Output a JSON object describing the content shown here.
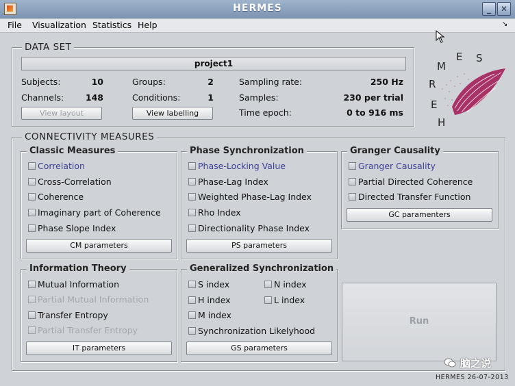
{
  "window": {
    "title": "HERMES"
  },
  "menu": [
    "File",
    "Visualization",
    "Statistics",
    "Help"
  ],
  "dataset": {
    "legend": "DATA SET",
    "project": "project1",
    "subjects_label": "Subjects:",
    "subjects": "10",
    "channels_label": "Channels:",
    "channels": "148",
    "groups_label": "Groups:",
    "groups": "2",
    "conditions_label": "Conditions:",
    "conditions": "1",
    "sampling_label": "Sampling rate:",
    "sampling": "250 Hz",
    "samples_label": "Samples:",
    "samples": "230 per trial",
    "epoch_label": "Time epoch:",
    "epoch": "0 to 916 ms",
    "view_layout": "View layout",
    "view_labelling": "View labelling"
  },
  "logo": {
    "text": "H E R M E S",
    "letters": [
      "H",
      "E",
      "R",
      "M",
      "E",
      "S"
    ]
  },
  "connectivity": {
    "legend": "CONNECTIVITY MEASURES",
    "classic": {
      "title": "Classic Measures",
      "items": [
        "Correlation",
        "Cross-Correlation",
        "Coherence",
        "Imaginary part of Coherence",
        "Phase Slope Index"
      ],
      "button": "CM parameters"
    },
    "phase": {
      "title": "Phase Synchronization",
      "items": [
        "Phase-Locking Value",
        "Phase-Lag Index",
        "Weighted Phase-Lag Index",
        "Rho Index",
        "Directionality Phase Index"
      ],
      "button": "PS parameters"
    },
    "granger": {
      "title": "Granger Causality",
      "items": [
        "Granger Causality",
        "Partial Directed Coherence",
        "Directed Transfer Function"
      ],
      "button": "GC paramenters"
    },
    "info": {
      "title": "Information Theory",
      "items": [
        "Mutual Information",
        "Partial Mutual Information",
        "Transfer Entropy",
        "Partial Transfer Entropy"
      ],
      "button": "IT parameters"
    },
    "general": {
      "title": "Generalized Synchronization",
      "items": [
        "S index",
        "N index",
        "H index",
        "L index",
        "M index",
        "Synchronization Likelyhood"
      ],
      "button": "GS parameters"
    },
    "run": "Run"
  },
  "footer": "HERMES 26-07-2013",
  "watermark": "脑之说",
  "colors": {
    "titlebar": "#8aa0bf",
    "background": "#cfd3d8",
    "link": "#3b3f93"
  }
}
